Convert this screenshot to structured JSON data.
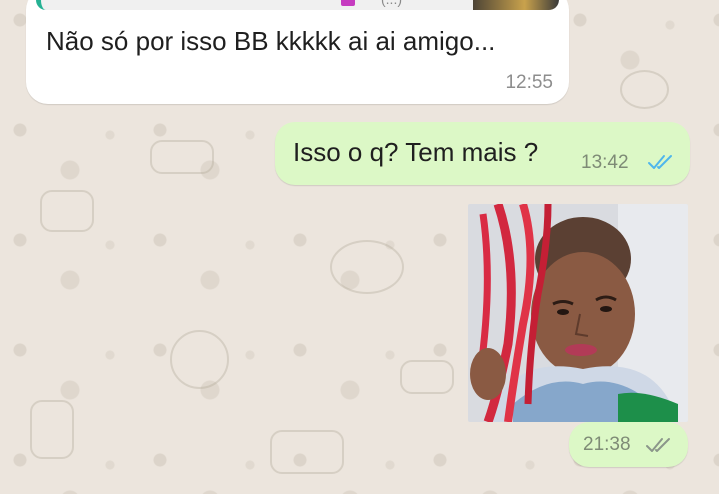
{
  "chat": {
    "messages": [
      {
        "direction": "incoming",
        "type": "text",
        "text": "Não só por isso BB kkkkk ai ai amigo...",
        "time": "12:55",
        "quoted_snippet": "(...)"
      },
      {
        "direction": "outgoing",
        "type": "text",
        "text": "Isso o q? Tem mais ?",
        "time": "13:42",
        "status": "read",
        "ticks_color": "#4fb6ec"
      },
      {
        "direction": "outgoing",
        "type": "image",
        "time": "21:38",
        "status": "delivered",
        "ticks_color": "#8b968a"
      }
    ]
  },
  "colors": {
    "wallpaper": "#ece5dd",
    "incoming_bubble": "#ffffff",
    "outgoing_bubble": "#dcf8c6",
    "quote_accent": "#25b193"
  }
}
